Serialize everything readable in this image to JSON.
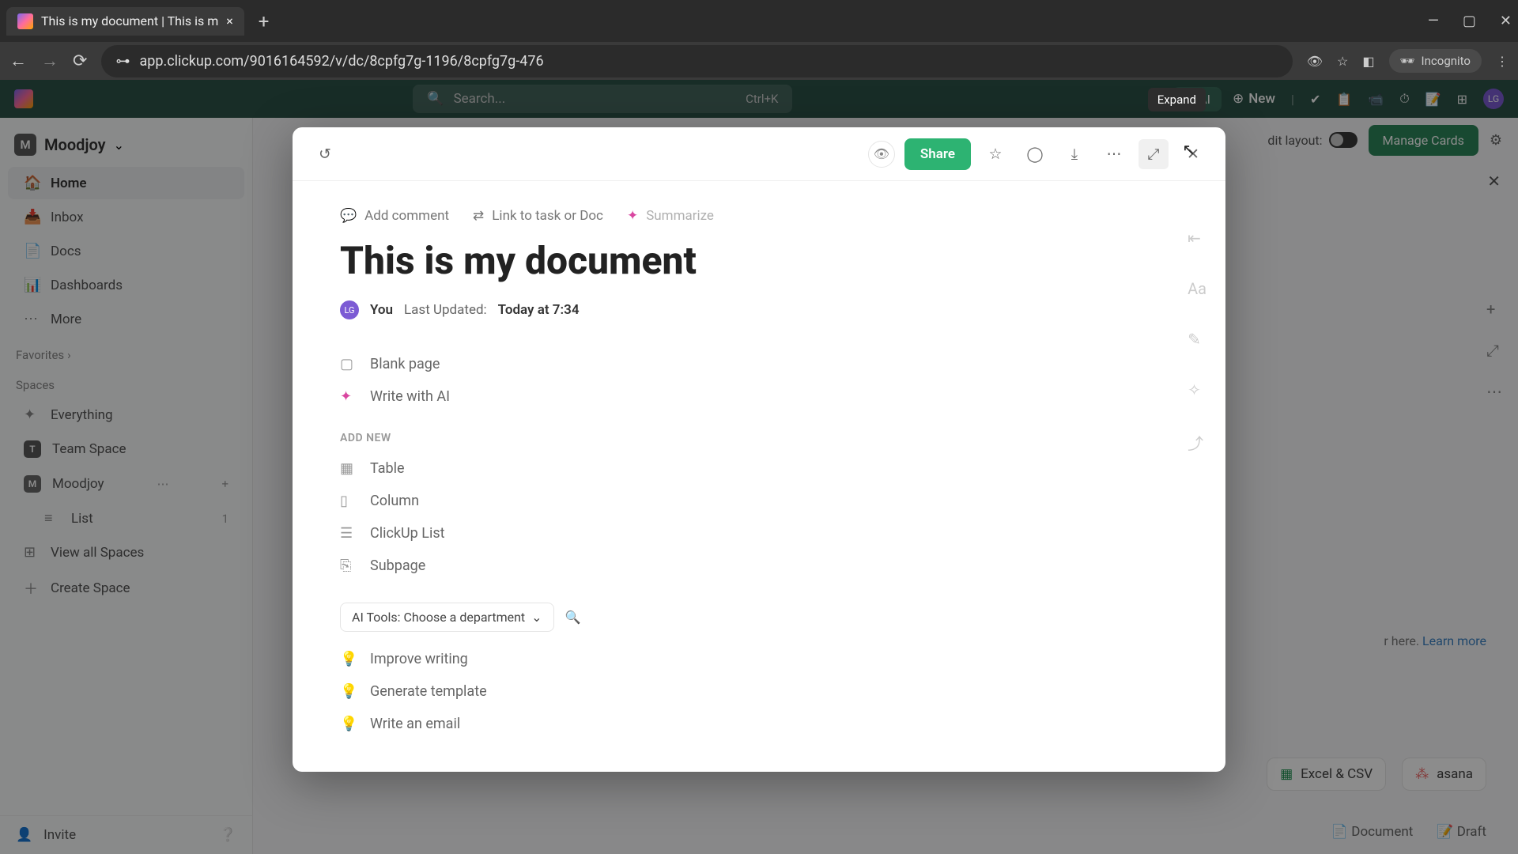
{
  "browser": {
    "tab_title": "This is my document | This is m",
    "url": "app.clickup.com/9016164592/v/dc/8cpfg7g-1196/8cpfg7g-476",
    "incognito_label": "Incognito"
  },
  "app_top": {
    "search_placeholder": "Search...",
    "search_shortcut": "Ctrl+K",
    "ai_label": "AI",
    "new_label": "New"
  },
  "sidebar": {
    "workspace_badge": "M",
    "workspace_name": "Moodjoy",
    "items": [
      {
        "icon": "🏠",
        "label": "Home",
        "active": true
      },
      {
        "icon": "📥",
        "label": "Inbox"
      },
      {
        "icon": "📄",
        "label": "Docs"
      },
      {
        "icon": "📊",
        "label": "Dashboards"
      },
      {
        "icon": "⋯",
        "label": "More"
      }
    ],
    "favorites_label": "Favorites",
    "spaces_label": "Spaces",
    "space_items": [
      {
        "type": "icon",
        "icon": "✦",
        "label": "Everything"
      },
      {
        "type": "badge",
        "badge": "T",
        "label": "Team Space"
      },
      {
        "type": "badge",
        "badge": "M",
        "label": "Moodjoy",
        "actions": true
      },
      {
        "type": "indent",
        "icon": "≡",
        "label": "List",
        "tail": "1"
      },
      {
        "type": "icon",
        "icon": "⊞",
        "label": "View all Spaces"
      },
      {
        "type": "icon",
        "icon": "＋",
        "label": "Create Space"
      }
    ],
    "invite_label": "Invite"
  },
  "bg": {
    "edit_layout_label": "dit layout:",
    "manage_cards": "Manage Cards",
    "hint_text": "r here. ",
    "hint_link": "Learn more",
    "pill1": "Excel & CSV",
    "pill2": "asana",
    "foot1": "Document",
    "foot2": "Draft"
  },
  "tooltip": "Expand",
  "modal": {
    "share": "Share",
    "actions": {
      "add_comment": "Add comment",
      "link_task": "Link to task or Doc",
      "summarize": "Summarize"
    },
    "title": "This is my document",
    "meta": {
      "avatar": "LG",
      "you": "You",
      "updated_label": "Last Updated:",
      "updated_value": "Today at 7:34"
    },
    "options": {
      "blank": "Blank page",
      "write_ai": "Write with AI",
      "add_new": "ADD NEW",
      "table": "Table",
      "column": "Column",
      "clickup_list": "ClickUp List",
      "subpage": "Subpage",
      "ai_tools": "AI Tools: Choose a department",
      "improve": "Improve writing",
      "template": "Generate template",
      "email": "Write an email"
    }
  }
}
